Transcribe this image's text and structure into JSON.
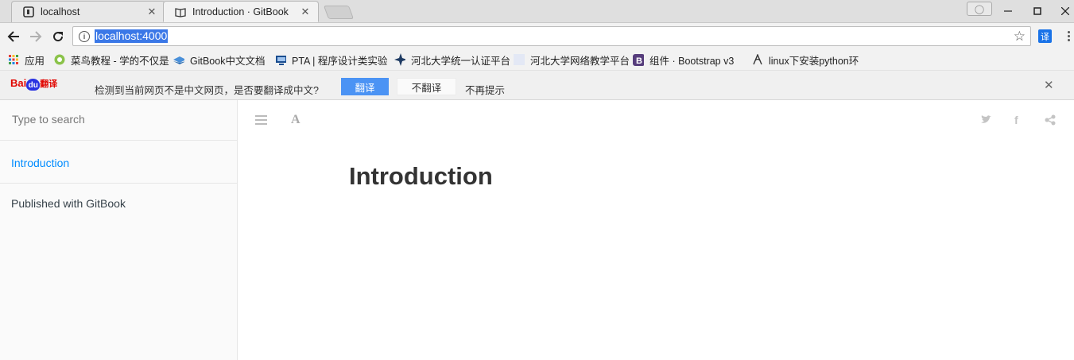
{
  "tabs": [
    {
      "title": "localhost",
      "icon": "page-icon"
    },
    {
      "title": "Introduction · GitBook",
      "icon": "book-icon"
    }
  ],
  "address_bar": {
    "url": "localhost:4000"
  },
  "bookmarks": [
    {
      "label": "应用",
      "icon": "apps-grid-icon"
    },
    {
      "label": "菜鸟教程 - 学的不仅是",
      "icon": "runoob-icon"
    },
    {
      "label": "GitBook中文文档",
      "icon": "gitbook-icon"
    },
    {
      "label": "PTA | 程序设计类实验",
      "icon": "pta-icon"
    },
    {
      "label": "河北大学统一认证平台",
      "icon": "hbu-icon"
    },
    {
      "label": "河北大学网络教学平台",
      "icon": "blank-page-icon"
    },
    {
      "label": "组件 · Bootstrap v3",
      "icon": "bootstrap-icon"
    },
    {
      "label": "linux下安装python环",
      "icon": "python-icon"
    }
  ],
  "translate_bar": {
    "brand": "Bai",
    "brand_du": "du",
    "brand_suffix": "翻译",
    "message": "检测到当前网页不是中文网页，是否要翻译成中文?",
    "translate_label": "翻译",
    "no_translate_label": "不翻译",
    "never_label": "不再提示"
  },
  "sidebar": {
    "search_placeholder": "Type to search",
    "items": [
      {
        "label": "Introduction",
        "active": true
      }
    ],
    "published": "Published with GitBook"
  },
  "content": {
    "heading": "Introduction"
  },
  "colors": {
    "link": "#008cff",
    "translate_button": "#4b93f4",
    "url_highlight": "#3b78e7"
  }
}
